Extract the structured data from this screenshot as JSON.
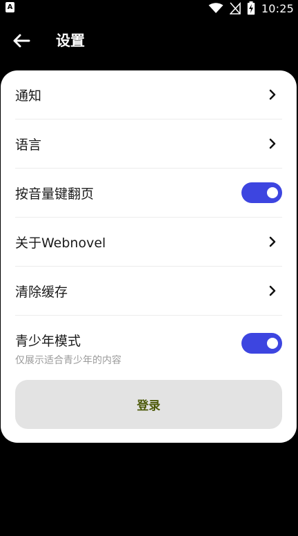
{
  "status_bar": {
    "app_icon_letter": "A",
    "time": "10:25",
    "icons": [
      "wifi-icon",
      "no-signal-icon",
      "battery-charging-icon"
    ]
  },
  "header": {
    "back_icon": "arrow-left-icon",
    "title": "设置"
  },
  "settings": {
    "items": [
      {
        "label": "通知",
        "control": "chevron"
      },
      {
        "label": "语言",
        "control": "chevron"
      },
      {
        "label": "按音量键翻页",
        "control": "toggle",
        "on": true
      },
      {
        "label": "关于Webnovel",
        "control": "chevron"
      },
      {
        "label": "清除缓存",
        "control": "chevron"
      },
      {
        "label": "青少年模式",
        "sublabel": "仅展示适合青少年的内容",
        "control": "toggle",
        "on": true
      }
    ]
  },
  "login": {
    "label": "登录"
  },
  "colors": {
    "toggle_on": "#3d45e0",
    "login_text": "#4d5a0a",
    "card_bg": "#ffffff",
    "screen_bg": "#000000"
  }
}
